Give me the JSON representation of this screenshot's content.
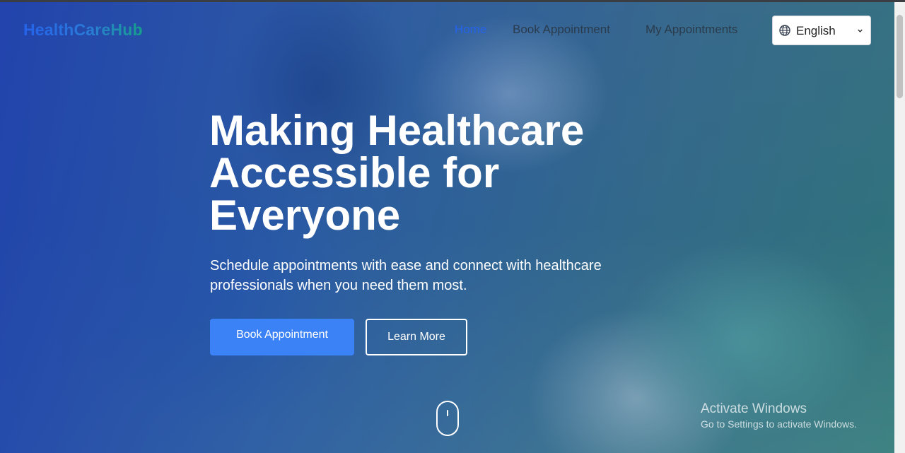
{
  "brand": {
    "logo_text": "HealthCareHub"
  },
  "nav": {
    "items": [
      {
        "label": "Home",
        "active": true
      },
      {
        "label": "Book Appointment",
        "active": false
      },
      {
        "label": "My Appointments",
        "active": false
      }
    ],
    "language": {
      "selected": "English",
      "icon": "globe-icon"
    }
  },
  "hero": {
    "headline_lines": [
      "Making Healthcare",
      "Accessible for",
      "Everyone"
    ],
    "subtitle": "Schedule appointments with ease and connect with healthcare professionals when you need them most.",
    "primary_button": "Book Appointment",
    "secondary_button": "Learn More",
    "scroll_indicator_icon": "mouse-scroll-icon"
  },
  "os_overlay": {
    "title": "Activate Windows",
    "subtitle": "Go to Settings to activate Windows."
  },
  "colors": {
    "brand_blue": "#2563eb",
    "brand_teal": "#14a08a",
    "primary_button": "#3b82f6",
    "hero_overlay": "#1e40af"
  }
}
